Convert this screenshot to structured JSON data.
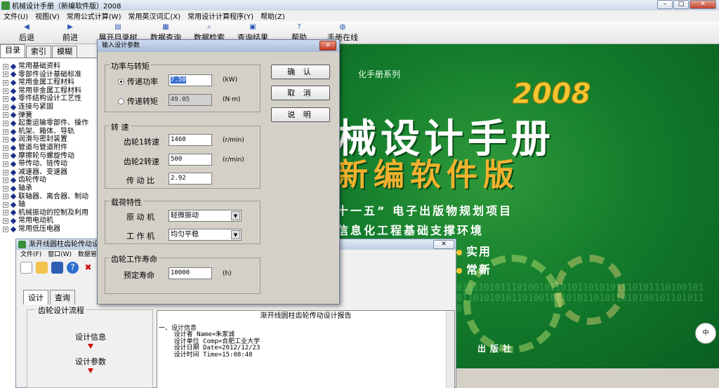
{
  "window": {
    "title": "机械设计手册（新编软件版）2008"
  },
  "menubar": [
    "文件(U)",
    "视图(V)",
    "常用公式计算(W)",
    "常用英汉词汇(X)",
    "常用设计计算程序(Y)",
    "帮助(Z)"
  ],
  "toolbar": {
    "back": "后退",
    "forward": "前进",
    "expand": "展开目录树",
    "query": "数据查询",
    "search": "数据检索",
    "results": "查询结果",
    "help": "帮助",
    "online": "手册在线"
  },
  "left_tabs": [
    "目录",
    "索引",
    "模糊"
  ],
  "tree": [
    "常用基础资料",
    "零部件设计基础标准",
    "常用金属工程材料",
    "常用非金属工程材料",
    "零件结构设计工艺性",
    "连接与紧固",
    "弹簧",
    "起重运输零部件、操作",
    "机架、箱体、导轨",
    "润滑与密封装置",
    "管道与管道附件",
    "摩擦轮与螺旋传动",
    "带传动、链传动",
    "减速器、变速器",
    "齿轮传动",
    "轴承",
    "联轴器、离合器、制动",
    "轴",
    "机械振动的控制及利用",
    "常用电动机",
    "常用低压电器"
  ],
  "splash": {
    "series": "化手册系列",
    "year": "2008",
    "title1": "械设计手册",
    "title2": "新编软件版",
    "line1": "十一五” 电子出版物规划项目",
    "line2": "信息化工程基础支撑环境",
    "bullet1": "实用",
    "bullet2": "常新",
    "binary": "0101101011101001011010110101011101011101001010110101010110100101101011010110101001011010110",
    "publisher": "出版社",
    "ime": "中"
  },
  "child": {
    "title": "渐开线圆柱齿轮传动设计",
    "menu": [
      "文件(F)",
      "窗口(W)",
      "数据管"
    ],
    "tabs": [
      "设计",
      "查询"
    ],
    "flow_legend": "齿轮设计流程",
    "flow_step1": "设计信息",
    "flow_step2": "设计参数",
    "report_title": "渐开线圆柱齿轮传动设计报告",
    "report_lines": [
      "一、设计信息",
      "    设计者 Name=朱家诚",
      "    设计单位 Comp=合肥工业大学",
      "    设计日期 Date=2012/12/23",
      "    设计时间 Time=15:08:48"
    ]
  },
  "dialog": {
    "title": "输入设计参数",
    "group_power": "功率与转矩",
    "radio_power": "传递功率",
    "power_value": "7.50",
    "power_unit": "(kW)",
    "radio_torque": "传递转矩",
    "torque_value": "49.05",
    "torque_unit": "(N·m)",
    "group_speed": "转  速",
    "gear1_label": "齿轮1转速",
    "gear1_value": "1460",
    "gear1_unit": "(r/min)",
    "gear2_label": "齿轮2转速",
    "gear2_value": "500",
    "gear2_unit": "(r/min)",
    "ratio_label": "传 动 比",
    "ratio_value": "2.92",
    "group_load": "载荷特性",
    "prime_label": "原 动 机",
    "prime_value": "轻微振动",
    "work_label": "工 作 机",
    "work_value": "均匀平稳",
    "group_life": "齿轮工作寿命",
    "life_label": "预定寿命",
    "life_value": "10000",
    "life_unit": "(h)",
    "btn_ok": "确 认",
    "btn_cancel": "取 消",
    "btn_help": "说 明"
  }
}
